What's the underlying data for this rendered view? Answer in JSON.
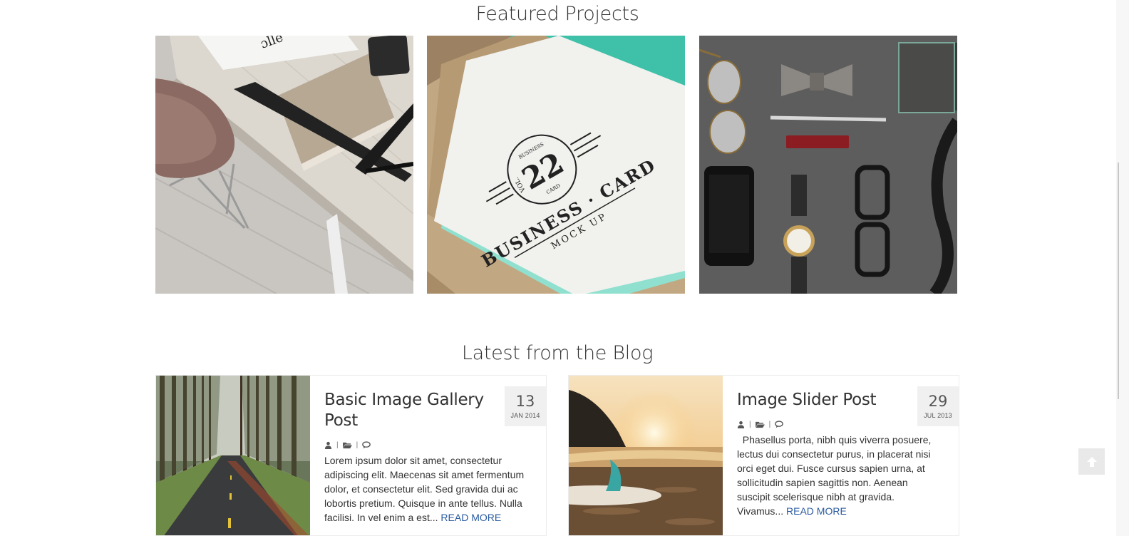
{
  "featured": {
    "title": "Featured Projects",
    "projects": [
      {
        "name": "Desk workspace"
      },
      {
        "name": "Business card mockup",
        "card_text": "BUSINESS · CARD",
        "card_sub": "MOCK UP",
        "card_number": "22",
        "badge_top": "BUSINESS",
        "badge_side": "CARD",
        "badge_vol": "VOL."
      },
      {
        "name": "Accessories flat lay"
      }
    ]
  },
  "blog": {
    "title": "Latest from the Blog",
    "posts": [
      {
        "title": "Basic Image Gallery Post",
        "day": "13",
        "month_year": "JAN 2014",
        "sep": "|",
        "excerpt": "Lorem ipsum dolor sit amet, consectetur adipiscing elit. Maecenas sit amet fermentum dolor, et consectetur elit. Sed gravida dui ac lobortis pretium. Quisque in ante tellus. Nulla facilisi. In vel enim a est...",
        "read_more": "READ MORE"
      },
      {
        "title": "Image Slider Post",
        "day": "29",
        "month_year": "JUL 2013",
        "sep": "|",
        "excerpt": "Phasellus porta, nibh quis viverra posuere, lectus dui consectetur purus, in placerat nisi orci eget dui. Fusce cursus sapien urna, at sollicitudin sapien sagittis non. Aenean suscipit scelerisque nibh at gravida. Vivamus...",
        "read_more": "READ MORE"
      }
    ]
  },
  "icons": {
    "author": "user-icon",
    "category": "folder-open-icon",
    "comments": "comments-icon",
    "scroll_top": "arrow-up-icon"
  },
  "colors": {
    "link": "#2a5aa0",
    "date_box": "#f0f0f0"
  }
}
